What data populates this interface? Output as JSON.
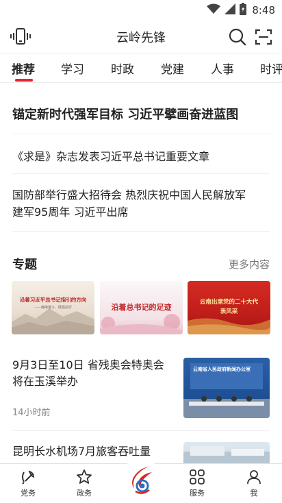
{
  "status_bar": {
    "time": "8:48",
    "icons": [
      "wifi-icon",
      "signal-icon",
      "battery-icon"
    ]
  },
  "header": {
    "title": "云岭先锋",
    "left_icon": "phone-vibrate-icon",
    "right_icons": [
      "search-icon",
      "scan-icon"
    ]
  },
  "tabs": [
    {
      "label": "推荐",
      "active": true
    },
    {
      "label": "学习",
      "active": false
    },
    {
      "label": "时政",
      "active": false
    },
    {
      "label": "党建",
      "active": false
    },
    {
      "label": "人事",
      "active": false
    },
    {
      "label": "时评",
      "active": false
    }
  ],
  "headlines": {
    "main": "锚定新时代强军目标 习近平擘画奋进蓝图",
    "sub1": "《求是》杂志发表习近平总书记重要文章",
    "sub2_line1": "国防部举行盛大招待会 热烈庆祝中国人民解放军",
    "sub2_line2": "建军95周年 习近平出席"
  },
  "topics": {
    "title": "专题",
    "more": "更多内容",
    "cards": [
      {
        "text": "沿着习近平总书记指引的方向",
        "subtext": "——继续奋斗、砥砺前行"
      },
      {
        "text": "沿着总书记的足迹"
      },
      {
        "text": "云南出席党的二十大代表风采"
      }
    ]
  },
  "news": [
    {
      "title": "9月3日至10日 省残奥会特奥会将在玉溪举办",
      "time": "14小时前",
      "thumb_text": "云南省人民政府新闻办公室"
    },
    {
      "title": "昆明长水机场7月旅客吞吐量",
      "time": ""
    }
  ],
  "bottom_nav": [
    {
      "label": "党务",
      "icon": "party-emblem-icon"
    },
    {
      "label": "政务",
      "icon": "star-icon"
    },
    {
      "label": "",
      "icon": "app-logo-icon"
    },
    {
      "label": "服务",
      "icon": "grid-icon"
    },
    {
      "label": "我",
      "icon": "user-icon"
    }
  ],
  "colors": {
    "accent": "#e4252b",
    "text": "#222222",
    "muted": "#888888"
  }
}
